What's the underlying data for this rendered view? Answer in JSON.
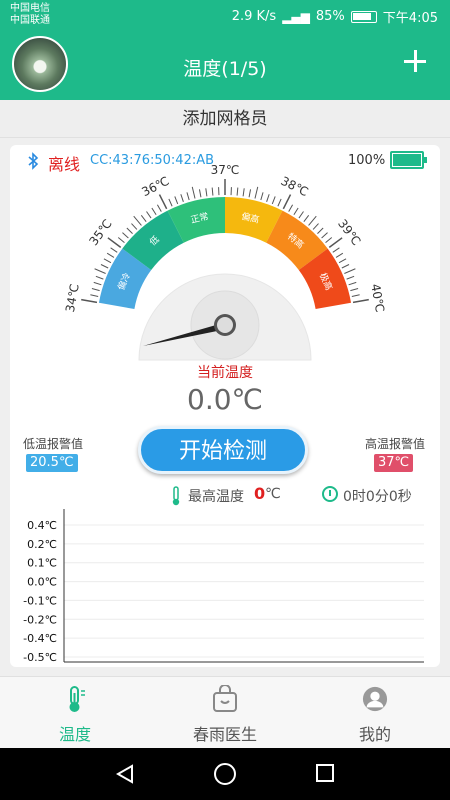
{
  "status_bar": {
    "carrier1": "中国电信",
    "carrier2": "中国联通",
    "network_speed": "2.9 K/s",
    "battery": "85%",
    "time": "下午4:05"
  },
  "header": {
    "title": "温度(1/5)",
    "add_icon": "plus-icon"
  },
  "add_grid_member": "添加网格员",
  "device": {
    "connection_status": "离线",
    "mac_address": "CC:43:76:50:42:AB",
    "battery_percent": "100%",
    "colors": {
      "offline": "#e02020",
      "mac": "#2a9be0",
      "battery": "#1eba8a"
    }
  },
  "gauge": {
    "scale_labels": [
      "34℃",
      "35℃",
      "36℃",
      "37℃",
      "38℃",
      "39℃",
      "40℃"
    ],
    "zones": [
      {
        "label": "偏冷",
        "color": "#4aa8e0"
      },
      {
        "label": "低",
        "color": "#1eb08a"
      },
      {
        "label": "正常",
        "color": "#2ec07a"
      },
      {
        "label": "偏高",
        "color": "#f5b80e"
      },
      {
        "label": "特高",
        "color": "#f78a1a"
      },
      {
        "label": "极高",
        "color": "#ef4a1a"
      }
    ],
    "current_temp_label": "当前温度",
    "current_temp_value": "0.0℃"
  },
  "alarms": {
    "low_label": "低温报警值",
    "low_value": "20.5℃",
    "high_label": "高温报警值",
    "high_value": "37℃"
  },
  "start_button_label": "开始检测",
  "stats": {
    "max_temp_label": "最高温度",
    "max_temp_value": "0",
    "max_temp_unit": "℃",
    "elapsed_time": "0时0分0秒"
  },
  "chart_data": {
    "type": "line",
    "title": "",
    "xlabel": "",
    "ylabel": "",
    "y_tick_labels": [
      "0.4℃",
      "0.2℃",
      "0.1℃",
      "0.0℃",
      "-0.1℃",
      "-0.2℃",
      "-0.4℃",
      "-0.5℃"
    ],
    "series": []
  },
  "bottom_nav": [
    {
      "label": "温度",
      "icon": "thermometer-icon",
      "active": true
    },
    {
      "label": "春雨医生",
      "icon": "bag-icon",
      "active": false
    },
    {
      "label": "我的",
      "icon": "profile-icon",
      "active": false
    }
  ]
}
